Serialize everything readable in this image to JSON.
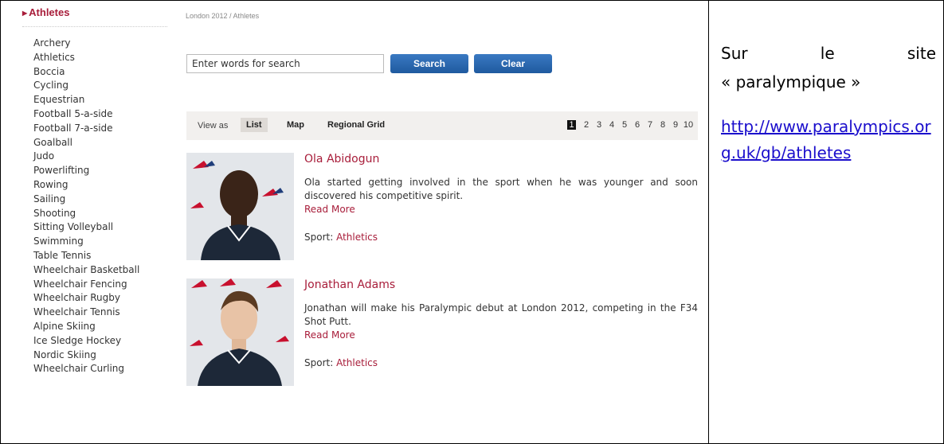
{
  "sidebar": {
    "heading": "Athletes",
    "sports": [
      "Archery",
      "Athletics",
      "Boccia",
      "Cycling",
      "Equestrian",
      "Football 5-a-side",
      "Football 7-a-side",
      "Goalball",
      "Judo",
      "Powerlifting",
      "Rowing",
      "Sailing",
      "Shooting",
      "Sitting Volleyball",
      "Swimming",
      "Table Tennis",
      "Wheelchair Basketball",
      "Wheelchair Fencing",
      "Wheelchair Rugby",
      "Wheelchair Tennis",
      "Alpine Skiing",
      "Ice Sledge Hockey",
      "Nordic Skiing",
      "Wheelchair Curling"
    ]
  },
  "breadcrumb": "London 2012 / Athletes",
  "search": {
    "value": "Enter words for search",
    "search_label": "Search",
    "clear_label": "Clear"
  },
  "viewbar": {
    "view_as": "View as",
    "options": [
      "List",
      "Map",
      "Regional Grid"
    ],
    "active": "List",
    "pages": [
      "1",
      "2",
      "3",
      "4",
      "5",
      "6",
      "7",
      "8",
      "9",
      "10"
    ],
    "current_page": "1"
  },
  "athletes": [
    {
      "name": "Ola Abidogun",
      "bio": "Ola started getting involved in the sport when he was younger and soon discovered his competitive spirit.",
      "read_more": "Read More",
      "sport_label": "Sport:",
      "sport": "Athletics"
    },
    {
      "name": "Jonathan Adams",
      "bio": "Jonathan will make his Paralympic debut at London 2012, competing in the F34 Shot Putt.",
      "read_more": "Read More",
      "sport_label": "Sport:",
      "sport": "Athletics"
    }
  ],
  "note": {
    "line1": [
      "Sur",
      "le",
      "site"
    ],
    "line2": "« paralympique »",
    "link": "http://www.paralympics.org.uk/gb/athletes"
  },
  "colors": {
    "accent": "#a81d3a",
    "button": "#2466b0",
    "link": "#1a0dcc"
  }
}
